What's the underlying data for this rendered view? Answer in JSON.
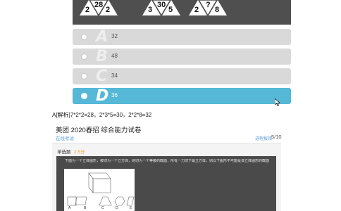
{
  "top_figures": [
    {
      "values": [
        "2",
        "28",
        "2"
      ]
    },
    {
      "values": [
        "3",
        "30",
        "5"
      ]
    },
    {
      "values": [
        "2",
        "?",
        "8"
      ]
    }
  ],
  "options": [
    {
      "letter": "A",
      "value": "32",
      "selected": false
    },
    {
      "letter": "B",
      "value": "48",
      "selected": false
    },
    {
      "letter": "C",
      "value": "34",
      "selected": false
    },
    {
      "letter": "D",
      "value": "36",
      "selected": true
    }
  ],
  "answer_text": "A[解析]7*2*2=28，2*3*5=30，2*2*8=32",
  "paper": {
    "title": "美团 2020春招 综合能力试卷",
    "subtitle": "在线考试",
    "report_label": "进程报错",
    "progress": "5/10",
    "section_label": "单选题",
    "score_label": "2.5分",
    "question_text": "下面为一个立体图形，被切为一个立方体，则切为一个等腰的截面，所有一刀切下最立方体，则以下图形不可能是该立体图形的截面的是（ ）",
    "figure_labels": [
      "A",
      "B",
      "C",
      "D",
      "E"
    ]
  },
  "colors": {
    "selected_option": "#55b8d6",
    "option_bg": "#d9d9d9",
    "panel_bg": "#4f4f4f",
    "link": "#5b9fd6",
    "score": "#f0a030"
  }
}
